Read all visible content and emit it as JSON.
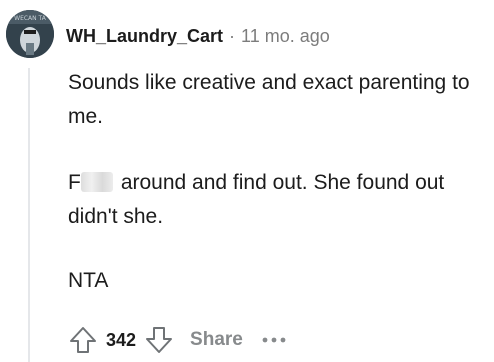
{
  "comment": {
    "username": "WH_Laundry_Cart",
    "separator": "·",
    "timestamp": "11 mo. ago",
    "avatar_caption": "WECAN TA",
    "paragraphs": {
      "p1": "Sounds like creative and exact parenting to me.",
      "p2_prefix": "F",
      "p2_rest": "around and find out. She found out didn't she.",
      "p3": "NTA"
    },
    "score": "342",
    "share_label": "Share",
    "more_label": "•••"
  },
  "icons": {
    "upvote": "arrow-up-outline-icon",
    "downvote": "arrow-down-outline-icon",
    "more": "more-horizontal-icon"
  },
  "colors": {
    "text": "#1c1c1c",
    "meta": "#7c7c7c",
    "action_muted": "#878a8c",
    "thread_line": "#e5e7ea"
  }
}
